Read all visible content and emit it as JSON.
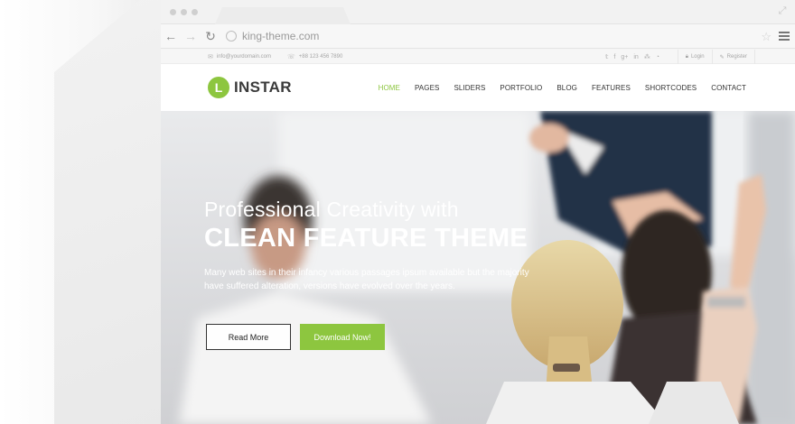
{
  "browser": {
    "url": "king-theme.com",
    "icons": {
      "back": "back-arrow-icon",
      "forward": "forward-arrow-icon",
      "reload": "reload-icon",
      "star": "bookmark-star-icon",
      "menu": "hamburger-menu-icon",
      "expand": "expand-icon"
    }
  },
  "topbar": {
    "email": "info@yourdomain.com",
    "phone": "+88 123 456 7890",
    "social": [
      "twitter-icon",
      "facebook-icon",
      "google-plus-icon",
      "linkedin-icon",
      "delicious-icon",
      "rss-icon"
    ],
    "login": "Login",
    "register": "Register"
  },
  "header": {
    "logo_letter": "L",
    "logo_text": "INSTAR",
    "nav": [
      {
        "label": "HOME",
        "active": true
      },
      {
        "label": "PAGES"
      },
      {
        "label": "SLIDERS"
      },
      {
        "label": "PORTFOLIO"
      },
      {
        "label": "BLOG"
      },
      {
        "label": "FEATURES"
      },
      {
        "label": "SHORTCODES"
      },
      {
        "label": "CONTACT"
      }
    ]
  },
  "hero": {
    "line1": "Professional Creativity with",
    "line2": "CLEAN FEATURE THEME",
    "desc": "Many web sites in their infancy various passages ipsum available but the majority have suffered alteration, versions have evolved over the years.",
    "read_more": "Read More",
    "download": "Download Now!"
  },
  "colors": {
    "accent": "#8dc63f",
    "text_dark": "#333333"
  }
}
